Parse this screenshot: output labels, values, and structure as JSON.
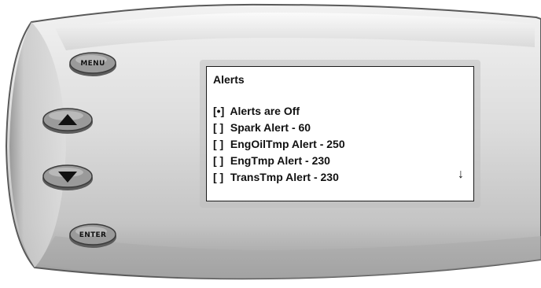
{
  "device": {
    "buttons": {
      "menu": {
        "label": "MENU",
        "icon": "button-label"
      },
      "up": {
        "icon": "triangle-up-icon"
      },
      "down": {
        "icon": "triangle-down-icon"
      },
      "enter": {
        "label": "ENTER",
        "icon": "button-label"
      }
    },
    "colors": {
      "bezel": "#d9d9d9",
      "button": "#8a8a8a",
      "screen": "#ffffff",
      "text": "#111111"
    }
  },
  "screen": {
    "title": "Alerts",
    "items": [
      {
        "checkbox": "[•]",
        "label": "Alerts are Off",
        "selected": true
      },
      {
        "checkbox": "[ ]",
        "label": "Spark Alert - 60",
        "selected": false
      },
      {
        "checkbox": "[ ]",
        "label": "EngOilTmp Alert - 250",
        "selected": false
      },
      {
        "checkbox": "[ ]",
        "label": "EngTmp Alert - 230",
        "selected": false
      },
      {
        "checkbox": "[ ]",
        "label": "TransTmp Alert - 230",
        "selected": false
      }
    ],
    "scroll_indicator": "↓"
  }
}
